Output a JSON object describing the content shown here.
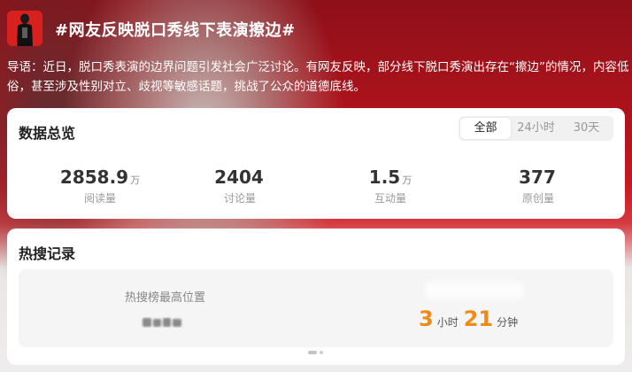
{
  "header": {
    "title": "#网友反映脱口秀线下表演擦边#",
    "avatar_icon": "person-silhouette-icon"
  },
  "intro": "导语：近日，脱口秀表演的边界问题引发社会广泛讨论。有网友反映，部分线下脱口秀演出存在“擦边”的情况，内容低俗，甚至涉及性别对立、歧视等敏感话题，挑战了公众的道德底线。",
  "overview": {
    "title": "数据总览",
    "tabs": [
      "全部",
      "24小时",
      "30天"
    ],
    "active_tab": "全部",
    "stats": [
      {
        "value": "2858.9",
        "unit": "万",
        "label": "阅读量"
      },
      {
        "value": "2404",
        "unit": "",
        "label": "讨论量"
      },
      {
        "value": "1.5",
        "unit": "万",
        "label": "互动量"
      },
      {
        "value": "377",
        "unit": "",
        "label": "原创量"
      }
    ]
  },
  "hot": {
    "title": "热搜记录",
    "peak_label": "热搜榜最高位置",
    "duration_hours": "3",
    "hours_unit": "小时",
    "duration_minutes": "21",
    "minutes_unit": "分钟"
  },
  "colors": {
    "accent_orange": "#f08a16",
    "header_red": "#c81922"
  }
}
